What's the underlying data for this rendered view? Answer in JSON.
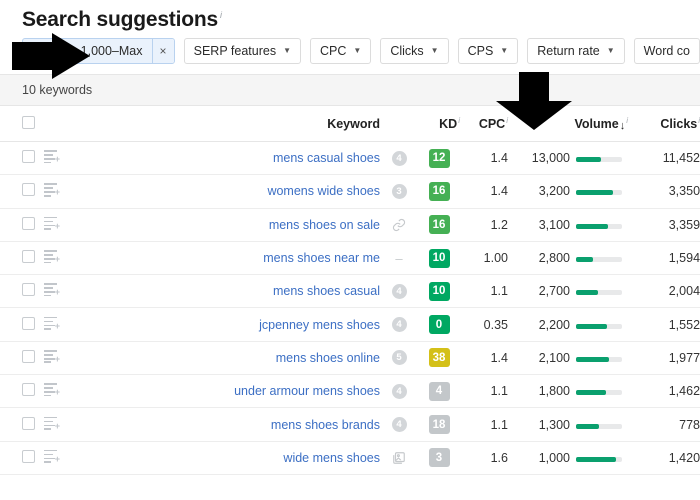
{
  "header": {
    "title": "Search suggestions",
    "info_marker": "i"
  },
  "filters": {
    "active_chip": {
      "label": "Volume: 1,000–Max",
      "close_icon": "×",
      "accent": "#b9d2ef",
      "background": "#eaf2fc"
    },
    "buttons": [
      {
        "label": "SERP features",
        "caret": "▼"
      },
      {
        "label": "CPC",
        "caret": "▼"
      },
      {
        "label": "Clicks",
        "caret": "▼"
      },
      {
        "label": "CPS",
        "caret": "▼"
      },
      {
        "label": "Return rate",
        "caret": "▼"
      },
      {
        "label": "Word co",
        "caret": ""
      }
    ]
  },
  "results": {
    "count_label": "10 keywords"
  },
  "table": {
    "columns": {
      "keyword": "Keyword",
      "kd": "KD",
      "cpc": "CPC",
      "volume": "Volume",
      "clicks": "Clicks",
      "sort_arrow": "↓",
      "info_marker": "i"
    },
    "rows": [
      {
        "keyword": "mens casual shoes",
        "serp": "4",
        "serp_type": "count",
        "kd": "12",
        "kd_color": "#45b054",
        "cpc": "1.4",
        "volume": "13,000",
        "bar_pct": 55,
        "clicks": "11,452"
      },
      {
        "keyword": "womens wide shoes",
        "serp": "3",
        "serp_type": "count",
        "kd": "16",
        "kd_color": "#45b054",
        "cpc": "1.4",
        "volume": "3,200",
        "bar_pct": 80,
        "clicks": "3,350"
      },
      {
        "keyword": "mens shoes on sale",
        "serp": "link",
        "serp_type": "icon",
        "kd": "16",
        "kd_color": "#45b054",
        "cpc": "1.2",
        "volume": "3,100",
        "bar_pct": 70,
        "clicks": "3,359"
      },
      {
        "keyword": "mens shoes near me",
        "serp": "–",
        "serp_type": "dash",
        "kd": "10",
        "kd_color": "#00a862",
        "cpc": "1.00",
        "volume": "2,800",
        "bar_pct": 38,
        "clicks": "1,594"
      },
      {
        "keyword": "mens shoes casual",
        "serp": "4",
        "serp_type": "count",
        "kd": "10",
        "kd_color": "#00a862",
        "cpc": "1.1",
        "volume": "2,700",
        "bar_pct": 47,
        "clicks": "2,004"
      },
      {
        "keyword": "jcpenney mens shoes",
        "serp": "4",
        "serp_type": "count",
        "kd": "0",
        "kd_color": "#00a862",
        "cpc": "0.35",
        "volume": "2,200",
        "bar_pct": 68,
        "clicks": "1,552"
      },
      {
        "keyword": "mens shoes online",
        "serp": "5",
        "serp_type": "count",
        "kd": "38",
        "kd_color": "#d4c018",
        "cpc": "1.4",
        "volume": "2,100",
        "bar_pct": 72,
        "clicks": "1,977"
      },
      {
        "keyword": "under armour mens shoes",
        "serp": "4",
        "serp_type": "count",
        "kd": "4",
        "kd_color": "#c3c7ca",
        "cpc": "1.1",
        "volume": "1,800",
        "bar_pct": 66,
        "clicks": "1,462"
      },
      {
        "keyword": "mens shoes brands",
        "serp": "4",
        "serp_type": "count",
        "kd": "18",
        "kd_color": "#c3c7ca",
        "cpc": "1.1",
        "volume": "1,300",
        "bar_pct": 50,
        "clicks": "778"
      },
      {
        "keyword": "wide mens shoes",
        "serp": "image",
        "serp_type": "icon",
        "kd": "3",
        "kd_color": "#c3c7ca",
        "cpc": "1.6",
        "volume": "1,000",
        "bar_pct": 88,
        "clicks": "1,420"
      }
    ]
  },
  "annotations": {
    "arrow_right_target": "Volume: 1,000–Max filter chip",
    "arrow_down_target": "Volume column header",
    "arrow_color": "#000000"
  }
}
